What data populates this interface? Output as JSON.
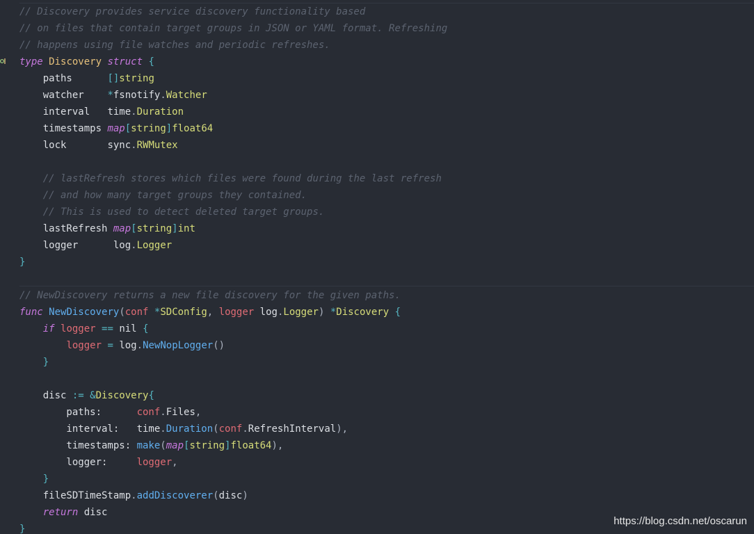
{
  "editor": {
    "lines": [
      [
        {
          "t": "// Discovery provides service discovery functionality based",
          "k": "comment"
        }
      ],
      [
        {
          "t": "// on files that contain target groups in JSON or YAML format. Refreshing",
          "k": "comment"
        }
      ],
      [
        {
          "t": "// happens using file watches and periodic refreshes.",
          "k": "comment"
        }
      ],
      [
        {
          "t": "type",
          "k": "keyword"
        },
        {
          "t": " ",
          "k": "punct"
        },
        {
          "t": "Discovery",
          "k": "type"
        },
        {
          "t": " ",
          "k": "punct"
        },
        {
          "t": "struct",
          "k": "keyword"
        },
        {
          "t": " ",
          "k": "punct"
        },
        {
          "t": "{",
          "k": "brace"
        }
      ],
      [
        {
          "t": "    paths      ",
          "k": "ident"
        },
        {
          "t": "[]",
          "k": "op"
        },
        {
          "t": "string",
          "k": "builtin"
        }
      ],
      [
        {
          "t": "    watcher    ",
          "k": "ident"
        },
        {
          "t": "*",
          "k": "op"
        },
        {
          "t": "fsnotify",
          "k": "ident"
        },
        {
          "t": ".",
          "k": "punct"
        },
        {
          "t": "Watcher",
          "k": "builtin"
        }
      ],
      [
        {
          "t": "    interval   ",
          "k": "ident"
        },
        {
          "t": "time",
          "k": "ident"
        },
        {
          "t": ".",
          "k": "punct"
        },
        {
          "t": "Duration",
          "k": "builtin"
        }
      ],
      [
        {
          "t": "    timestamps ",
          "k": "ident"
        },
        {
          "t": "map",
          "k": "keyword"
        },
        {
          "t": "[",
          "k": "op"
        },
        {
          "t": "string",
          "k": "builtin"
        },
        {
          "t": "]",
          "k": "op"
        },
        {
          "t": "float64",
          "k": "builtin"
        }
      ],
      [
        {
          "t": "    lock       ",
          "k": "ident"
        },
        {
          "t": "sync",
          "k": "ident"
        },
        {
          "t": ".",
          "k": "punct"
        },
        {
          "t": "RWMutex",
          "k": "builtin"
        }
      ],
      [],
      [
        {
          "t": "    ",
          "k": "punct"
        },
        {
          "t": "// lastRefresh stores which files were found during the last refresh",
          "k": "comment"
        }
      ],
      [
        {
          "t": "    ",
          "k": "punct"
        },
        {
          "t": "// and how many target groups they contained.",
          "k": "comment"
        }
      ],
      [
        {
          "t": "    ",
          "k": "punct"
        },
        {
          "t": "// This is used to detect deleted target groups.",
          "k": "comment"
        }
      ],
      [
        {
          "t": "    lastRefresh ",
          "k": "ident"
        },
        {
          "t": "map",
          "k": "keyword"
        },
        {
          "t": "[",
          "k": "op"
        },
        {
          "t": "string",
          "k": "builtin"
        },
        {
          "t": "]",
          "k": "op"
        },
        {
          "t": "int",
          "k": "builtin"
        }
      ],
      [
        {
          "t": "    logger      ",
          "k": "ident"
        },
        {
          "t": "log",
          "k": "ident"
        },
        {
          "t": ".",
          "k": "punct"
        },
        {
          "t": "Logger",
          "k": "builtin"
        }
      ],
      [
        {
          "t": "}",
          "k": "brace"
        }
      ],
      [],
      [
        {
          "t": "// NewDiscovery returns a new file discovery for the given paths.",
          "k": "comment"
        }
      ],
      [
        {
          "t": "func",
          "k": "keyword"
        },
        {
          "t": " ",
          "k": "punct"
        },
        {
          "t": "NewDiscovery",
          "k": "func"
        },
        {
          "t": "(",
          "k": "punct"
        },
        {
          "t": "conf",
          "k": "param"
        },
        {
          "t": " ",
          "k": "punct"
        },
        {
          "t": "*",
          "k": "op"
        },
        {
          "t": "SDConfig",
          "k": "builtin"
        },
        {
          "t": ", ",
          "k": "punct"
        },
        {
          "t": "logger",
          "k": "param"
        },
        {
          "t": " ",
          "k": "punct"
        },
        {
          "t": "log",
          "k": "ident"
        },
        {
          "t": ".",
          "k": "punct"
        },
        {
          "t": "Logger",
          "k": "builtin"
        },
        {
          "t": ") ",
          "k": "punct"
        },
        {
          "t": "*",
          "k": "op"
        },
        {
          "t": "Discovery",
          "k": "builtin"
        },
        {
          "t": " ",
          "k": "punct"
        },
        {
          "t": "{",
          "k": "brace"
        }
      ],
      [
        {
          "t": "    ",
          "k": "punct"
        },
        {
          "t": "if",
          "k": "keyword"
        },
        {
          "t": " ",
          "k": "punct"
        },
        {
          "t": "logger",
          "k": "param"
        },
        {
          "t": " ",
          "k": "punct"
        },
        {
          "t": "==",
          "k": "op"
        },
        {
          "t": " ",
          "k": "punct"
        },
        {
          "t": "nil",
          "k": "ident"
        },
        {
          "t": " ",
          "k": "punct"
        },
        {
          "t": "{",
          "k": "brace"
        }
      ],
      [
        {
          "t": "        ",
          "k": "punct"
        },
        {
          "t": "logger",
          "k": "param"
        },
        {
          "t": " ",
          "k": "punct"
        },
        {
          "t": "=",
          "k": "op"
        },
        {
          "t": " ",
          "k": "punct"
        },
        {
          "t": "log",
          "k": "ident"
        },
        {
          "t": ".",
          "k": "punct"
        },
        {
          "t": "NewNopLogger",
          "k": "func"
        },
        {
          "t": "()",
          "k": "punct"
        }
      ],
      [
        {
          "t": "    ",
          "k": "punct"
        },
        {
          "t": "}",
          "k": "brace"
        }
      ],
      [],
      [
        {
          "t": "    disc ",
          "k": "ident"
        },
        {
          "t": ":=",
          "k": "op"
        },
        {
          "t": " ",
          "k": "punct"
        },
        {
          "t": "&",
          "k": "op"
        },
        {
          "t": "Discovery",
          "k": "builtin"
        },
        {
          "t": "{",
          "k": "brace"
        }
      ],
      [
        {
          "t": "        paths:      ",
          "k": "ident"
        },
        {
          "t": "conf",
          "k": "param"
        },
        {
          "t": ".",
          "k": "punct"
        },
        {
          "t": "Files",
          "k": "ident"
        },
        {
          "t": ",",
          "k": "punct"
        }
      ],
      [
        {
          "t": "        interval:   ",
          "k": "ident"
        },
        {
          "t": "time",
          "k": "ident"
        },
        {
          "t": ".",
          "k": "punct"
        },
        {
          "t": "Duration",
          "k": "func"
        },
        {
          "t": "(",
          "k": "punct"
        },
        {
          "t": "conf",
          "k": "param"
        },
        {
          "t": ".",
          "k": "punct"
        },
        {
          "t": "RefreshInterval",
          "k": "ident"
        },
        {
          "t": "),",
          "k": "punct"
        }
      ],
      [
        {
          "t": "        timestamps: ",
          "k": "ident"
        },
        {
          "t": "make",
          "k": "func"
        },
        {
          "t": "(",
          "k": "punct"
        },
        {
          "t": "map",
          "k": "keyword"
        },
        {
          "t": "[",
          "k": "op"
        },
        {
          "t": "string",
          "k": "builtin"
        },
        {
          "t": "]",
          "k": "op"
        },
        {
          "t": "float64",
          "k": "builtin"
        },
        {
          "t": "),",
          "k": "punct"
        }
      ],
      [
        {
          "t": "        logger:     ",
          "k": "ident"
        },
        {
          "t": "logger",
          "k": "param"
        },
        {
          "t": ",",
          "k": "punct"
        }
      ],
      [
        {
          "t": "    ",
          "k": "punct"
        },
        {
          "t": "}",
          "k": "brace"
        }
      ],
      [
        {
          "t": "    fileSDTimeStamp",
          "k": "ident"
        },
        {
          "t": ".",
          "k": "punct"
        },
        {
          "t": "addDiscoverer",
          "k": "func"
        },
        {
          "t": "(",
          "k": "punct"
        },
        {
          "t": "disc",
          "k": "ident"
        },
        {
          "t": ")",
          "k": "punct"
        }
      ],
      [
        {
          "t": "    ",
          "k": "punct"
        },
        {
          "t": "return",
          "k": "keyword"
        },
        {
          "t": " disc",
          "k": "ident"
        }
      ],
      [
        {
          "t": "}",
          "k": "brace"
        }
      ]
    ],
    "colors": {
      "background": "#282c34",
      "comment": "#5c6370",
      "keyword": "#c678dd",
      "type": "#e5c07b",
      "builtin": "#d7dd7a",
      "function": "#61afef",
      "parameter": "#e06c75",
      "operator": "#56b6c2",
      "identifier": "#dcdfe4"
    }
  },
  "gutter": {
    "marker_icon": "implements-interface-icon"
  },
  "watermark": {
    "text": "https://blog.csdn.net/oscarun"
  }
}
